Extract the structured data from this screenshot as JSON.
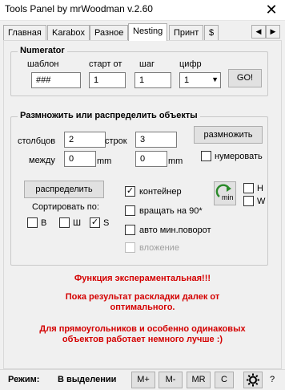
{
  "window": {
    "title": "Tools Panel by mrWoodman v.2.60",
    "close_glyph": "✕"
  },
  "tabs": [
    "Главная",
    "Karabox",
    "Разное",
    "Nesting",
    "Принт",
    "$"
  ],
  "active_tab": "Nesting",
  "numerator": {
    "title": "Numerator",
    "labels": {
      "template": "шаблон",
      "start": "старт от",
      "step": "шаг",
      "digits": "цифр"
    },
    "values": {
      "template": "###",
      "start": "1",
      "step": "1",
      "digits": "1"
    },
    "go_label": "GO!"
  },
  "multiply": {
    "title": "Размножить или распределить объекты",
    "cols_label": "столбцов",
    "cols_value": "2",
    "rows_label": "строк",
    "rows_value": "3",
    "between_label": "между",
    "gap1_value": "0",
    "gap2_value": "0",
    "unit": "mm",
    "multiply_button": "размножить",
    "numerate_label": "нумеровать",
    "distribute_button": "распределить",
    "sort_label": "Сортировать по:",
    "sort_options": [
      {
        "label": "В",
        "checked": false
      },
      {
        "label": "Ш",
        "checked": false
      },
      {
        "label": "S",
        "checked": true
      }
    ],
    "container_label": "контейнер",
    "rotate90_label": "вращать на 90*",
    "auto_rotate_label": "авто мин.поворот",
    "nesting_label": "вложение",
    "h_label": "H",
    "w_label": "W",
    "min_icon_text": "min"
  },
  "notes": {
    "line1": "Функция экспераментальная!!!",
    "line2a": "Пока результат раскладки  далек от",
    "line2b": "оптимального.",
    "line3a": "Для прямоугольников и особенно одинаковых",
    "line3b": "объектов работает немного лучше :)"
  },
  "status": {
    "mode_label": "Режим:",
    "mode_value": "В выделении",
    "buttons": [
      "M+",
      "M-",
      "MR",
      "C"
    ],
    "help": "?"
  }
}
